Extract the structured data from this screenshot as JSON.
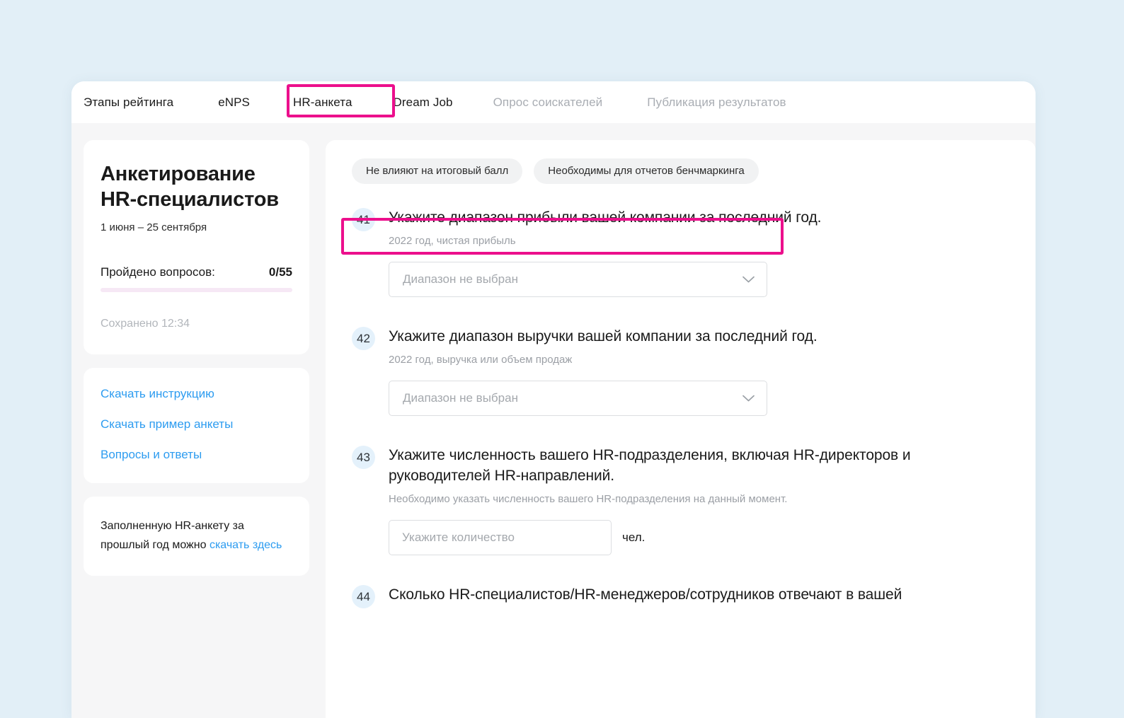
{
  "theme": {
    "page_bg": "#e2eff7",
    "panel_bg": "#f6f6f7",
    "accent_highlight": "#ec0f8c",
    "link_color": "#2d9cf0",
    "badge_bg": "#e4f1fb",
    "chip_bg": "#f1f2f3",
    "progress_track": "#f6e8f5"
  },
  "tabs": [
    {
      "label": "Этапы рейтинга",
      "active": false,
      "disabled": false
    },
    {
      "label": "eNPS",
      "active": false,
      "disabled": false
    },
    {
      "label": "HR-анкета",
      "active": true,
      "disabled": false
    },
    {
      "label": "Dream Job",
      "active": false,
      "disabled": false
    },
    {
      "label": "Опрос соискателей",
      "active": false,
      "disabled": true
    },
    {
      "label": "Публикация результатов",
      "active": false,
      "disabled": true
    }
  ],
  "sidebar": {
    "survey": {
      "title": "Анкетирование HR-специалистов",
      "dates": "1 июня – 25 сентября",
      "progress_label": "Пройдено вопросов:",
      "progress_value": "0/55",
      "progress_percent": 0,
      "saved_text": "Сохранено 12:34"
    },
    "links": [
      {
        "label": "Скачать инструкцию"
      },
      {
        "label": "Скачать пример анкеты"
      },
      {
        "label": "Вопросы и ответы"
      }
    ],
    "note": {
      "text_before": "Заполненную HR-анкету за прошлый год можно ",
      "link_text": "скачать здесь"
    }
  },
  "main": {
    "filters": [
      {
        "label": "Не влияют на итоговый балл"
      },
      {
        "label": "Необходимы для отчетов бенчмаркинга"
      }
    ],
    "questions": [
      {
        "number": "41",
        "title": "Укажите диапазон прибыли вашей компании за последний год.",
        "subtitle": "2022 год, чистая прибыль",
        "control": "select",
        "placeholder": "Диапазон не выбран",
        "value": ""
      },
      {
        "number": "42",
        "title": "Укажите диапазон выручки вашей компании за последний год.",
        "subtitle": "2022 год, выручка или объем продаж",
        "control": "select",
        "placeholder": "Диапазон не выбран",
        "value": ""
      },
      {
        "number": "43",
        "title": "Укажите численность вашего HR-подразделения, включая HR-директоров и руководителей HR-направлений.",
        "subtitle": "Необходимо указать численность вашего HR-подразделения на данный момент.",
        "control": "number",
        "placeholder": "Укажите количество",
        "value": "",
        "unit": "чел."
      },
      {
        "number": "44",
        "title": "Сколько HR-специалистов/HR-менеджеров/сотрудников отвечают в вашей",
        "subtitle": "",
        "control": "none",
        "placeholder": "",
        "value": ""
      }
    ]
  }
}
